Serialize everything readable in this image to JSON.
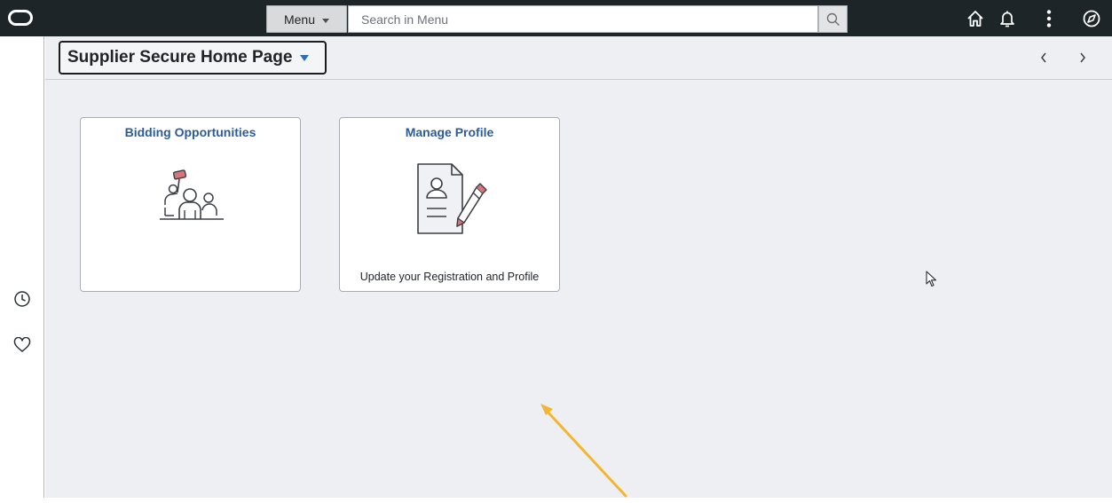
{
  "topbar": {
    "logo_icon": "oracle-ring-icon",
    "menu_label": "Menu",
    "search_placeholder": "Search in Menu",
    "icons": [
      "home-icon",
      "notification-bell-icon",
      "actions-kebab-icon",
      "navbar-compass-icon"
    ]
  },
  "header": {
    "homepage_title": "Supplier Secure Home Page",
    "prev_icon": "chevron-left-icon",
    "next_icon": "chevron-right-icon"
  },
  "left_rail": {
    "icons": [
      "recent-clock-icon",
      "favorites-heart-icon"
    ]
  },
  "tiles": [
    {
      "title": "Bidding Opportunities",
      "description": "",
      "icon": "auction-bidders-icon"
    },
    {
      "title": "Manage Profile",
      "description": "Update your Registration and Profile",
      "icon": "profile-document-pencil-icon"
    }
  ],
  "colors": {
    "topbar_bg": "#1e2528",
    "page_bg": "#eeeff3",
    "tile_title": "#2b5c98",
    "annotation_arrow": "#f2b632",
    "paddle_red": "#d9747c"
  }
}
